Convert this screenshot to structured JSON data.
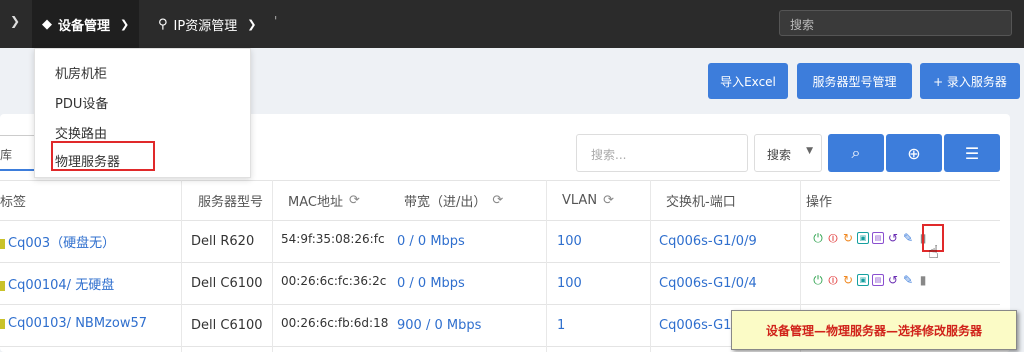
{
  "topbar": {
    "nav_device": "设备管理",
    "nav_ip": "IP资源管理",
    "tick": "'",
    "search_placeholder": "搜索"
  },
  "dropdown": {
    "items": [
      "机房机柜",
      "PDU设备",
      "交换路由",
      "物理服务器"
    ],
    "selected": "物理服务器"
  },
  "actions": {
    "import_excel": "导入Excel",
    "model_manage": "服务器型号管理",
    "add_server": "+ 录入服务器"
  },
  "filters": {
    "left_value": "库",
    "search_placeholder": "搜索...",
    "select_value": "搜索"
  },
  "table": {
    "headers": [
      "标签",
      "服务器型号",
      "MAC地址",
      "带宽（进/出）",
      "VLAN",
      "交换机-端口",
      "操作"
    ],
    "rows": [
      {
        "label": "Cq003（硬盘无）",
        "model": "Dell R620",
        "mac": "54:9f:35:08:26:fc",
        "bandwidth": "0 / 0 Mbps",
        "vlan": "100",
        "switch_port": "Cq006s-G1/0/9"
      },
      {
        "label": "Cq00104/ 无硬盘",
        "model": "Dell C6100",
        "mac": "00:26:6c:fc:36:2c",
        "bandwidth": "0 / 0 Mbps",
        "vlan": "100",
        "switch_port": "Cq006s-G1/0/4"
      },
      {
        "label": "Cq00103/ NBMzow57",
        "model": "Dell C6100",
        "mac": "00:26:6c:fb:6d:18",
        "bandwidth": "900 / 0 Mbps",
        "vlan": "1",
        "switch_port": "Cq006s-G1/"
      }
    ]
  },
  "callout": "设备管理—物理服务器—选择修改服务器",
  "colors": {
    "primary": "#3d7ddb",
    "highlight": "#e0292a",
    "topbar": "#2b2b2b"
  }
}
